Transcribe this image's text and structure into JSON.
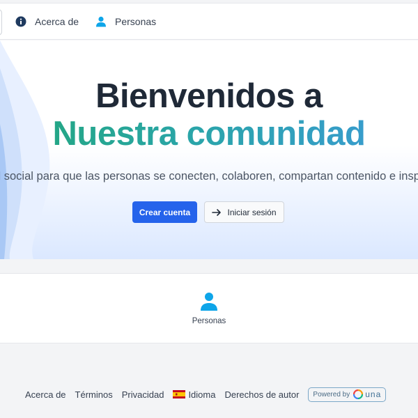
{
  "nav": {
    "items": [
      {
        "label": "Acerca de",
        "icon": "info-icon"
      },
      {
        "label": "Personas",
        "icon": "person-icon"
      }
    ]
  },
  "hero": {
    "title_line1": "Bienvenidos a",
    "title_line2": "Nuestra comunidad",
    "subtitle": "d social para que las personas se conecten, colaboren, compartan contenido e inspiren u",
    "primary_button": "Crear cuenta",
    "secondary_button": "Iniciar sesión",
    "colors": {
      "primary": "#2563eb",
      "gradient_start": "#22a77a",
      "gradient_end": "#3b9ad6"
    }
  },
  "card": {
    "items": [
      {
        "label": "Personas",
        "icon": "person-icon"
      }
    ]
  },
  "footer": {
    "links": [
      "Acerca de",
      "Términos",
      "Privacidad"
    ],
    "language": "Idioma",
    "copyright": "Derechos de autor",
    "powered_by": "Powered by",
    "brand": "una"
  }
}
